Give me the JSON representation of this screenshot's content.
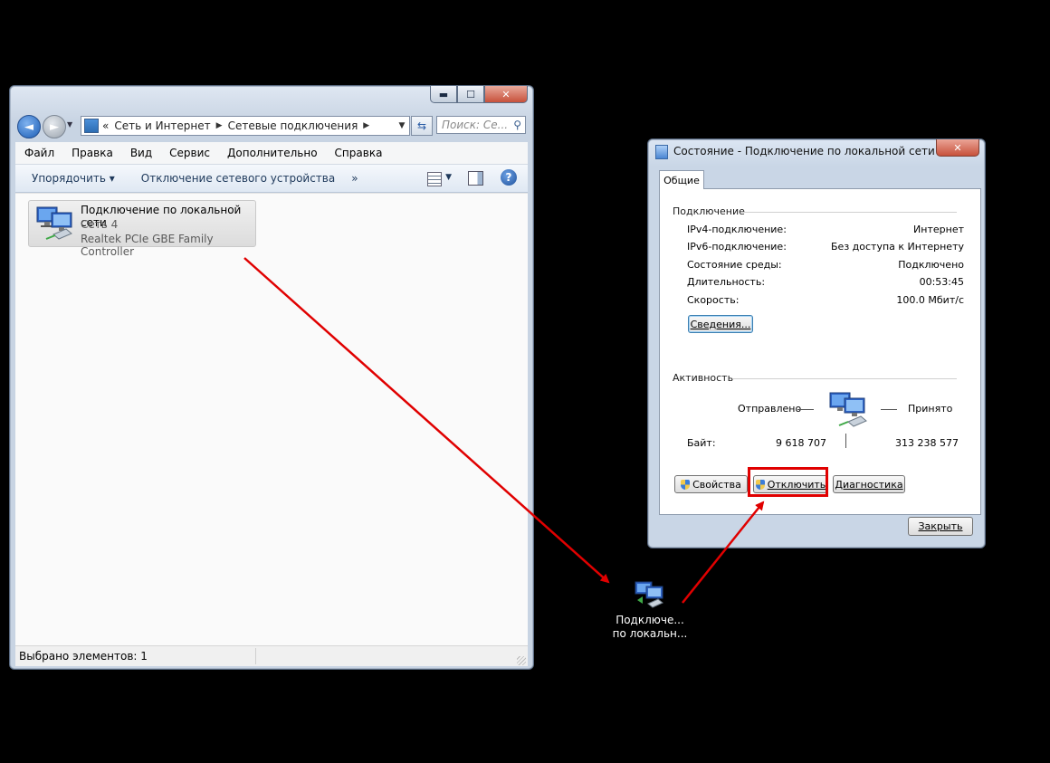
{
  "explorer": {
    "caption": {
      "minimize": "▬",
      "maximize": "☐",
      "close": "✕"
    },
    "address": {
      "prefix": "«",
      "crumbs": [
        "Сеть и Интернет",
        "Сетевые подключения"
      ]
    },
    "search_placeholder": "Поиск: Се...",
    "menu": [
      "Файл",
      "Правка",
      "Вид",
      "Сервис",
      "Дополнительно",
      "Справка"
    ],
    "toolbar": {
      "organize": "Упорядочить ▾",
      "disable_device": "Отключение сетевого устройства",
      "more": "»",
      "help": "?"
    },
    "item": {
      "name": "Подключение по локальной сети",
      "network": "Сеть  4",
      "adapter": "Realtek PCIe GBE Family Controller"
    },
    "status": "Выбрано элементов: 1"
  },
  "dialog": {
    "title": "Состояние - Подключение по локальной сети",
    "close": "✕",
    "tab": "Общие",
    "connection": {
      "heading": "Подключение",
      "rows": [
        {
          "label": "IPv4-подключение:",
          "value": "Интернет"
        },
        {
          "label": "IPv6-подключение:",
          "value": "Без доступа к Интернету"
        },
        {
          "label": "Состояние среды:",
          "value": "Подключено"
        },
        {
          "label": "Длительность:",
          "value": "00:53:45"
        },
        {
          "label": "Скорость:",
          "value": "100.0 Мбит/с"
        }
      ],
      "details_button": "Сведения..."
    },
    "activity": {
      "heading": "Активность",
      "sent_label": "Отправлено",
      "received_label": "Принято",
      "bytes_label": "Байт:",
      "sent_bytes": "9 618 707",
      "received_bytes": "313 238 577"
    },
    "buttons": {
      "properties": "Свойства",
      "disable": "Отключить",
      "diagnose": "Диагностика",
      "close": "Закрыть"
    }
  },
  "desktop_icon": {
    "line1": "Подключе...",
    "line2": "по локальн..."
  },
  "annotation_color": "#e00000"
}
